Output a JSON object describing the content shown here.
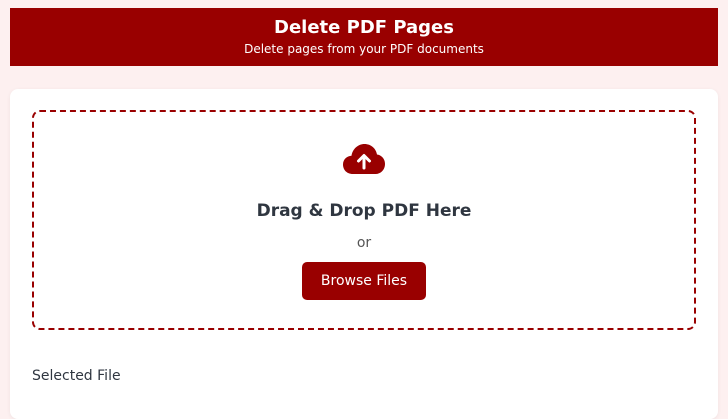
{
  "header": {
    "title": "Delete PDF Pages",
    "subtitle": "Delete pages from your PDF documents"
  },
  "dropzone": {
    "icon": "cloud-upload-icon",
    "title": "Drag & Drop PDF Here",
    "or_text": "or",
    "browse_label": "Browse Files"
  },
  "selected_file": {
    "label": "Selected File"
  },
  "colors": {
    "brand": "#990000",
    "background": "#fdf0f0",
    "text": "#2f3640"
  }
}
